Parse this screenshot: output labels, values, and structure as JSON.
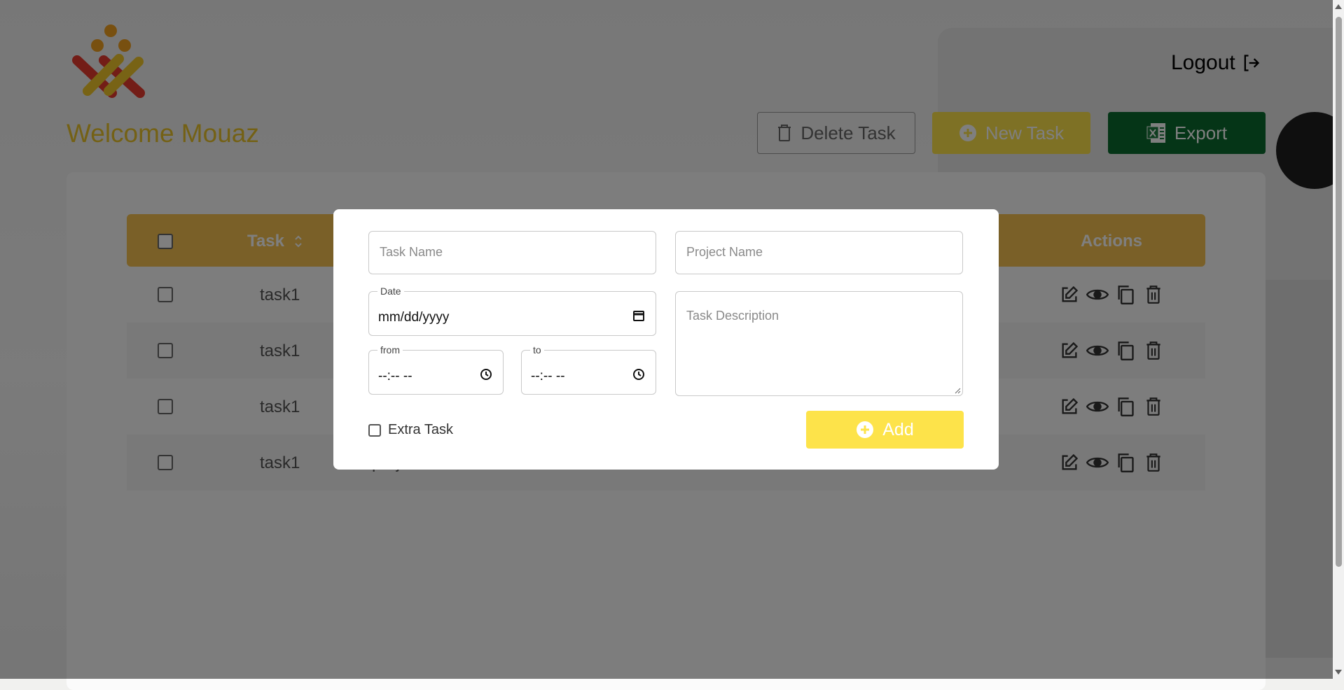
{
  "header": {
    "welcome": "Welcome Mouaz",
    "logout_label": "Logout",
    "delete_label": "Delete Task",
    "new_label": "New Task",
    "export_label": "Export"
  },
  "table": {
    "headers": {
      "task": "Task",
      "actions": "Actions"
    },
    "rows": [
      {
        "task": "task1",
        "project": ""
      },
      {
        "task": "task1",
        "project": ""
      },
      {
        "task": "task1",
        "project": ""
      },
      {
        "task": "task1",
        "project": "projec"
      }
    ]
  },
  "modal": {
    "task_name_placeholder": "Task Name",
    "project_name_placeholder": "Project Name",
    "date_label": "Date",
    "date_value": "mm/dd/yyyy",
    "description_placeholder": "Task Description",
    "from_label": "from",
    "from_value": "--:-- --",
    "to_label": "to",
    "to_value": "--:-- --",
    "extra_task_label": "Extra Task",
    "add_label": "Add"
  },
  "colors": {
    "accent_yellow": "#fde34a",
    "header_orange": "#f4c150",
    "export_green": "#0b6b2f",
    "welcome_gold": "#e9c22b"
  }
}
